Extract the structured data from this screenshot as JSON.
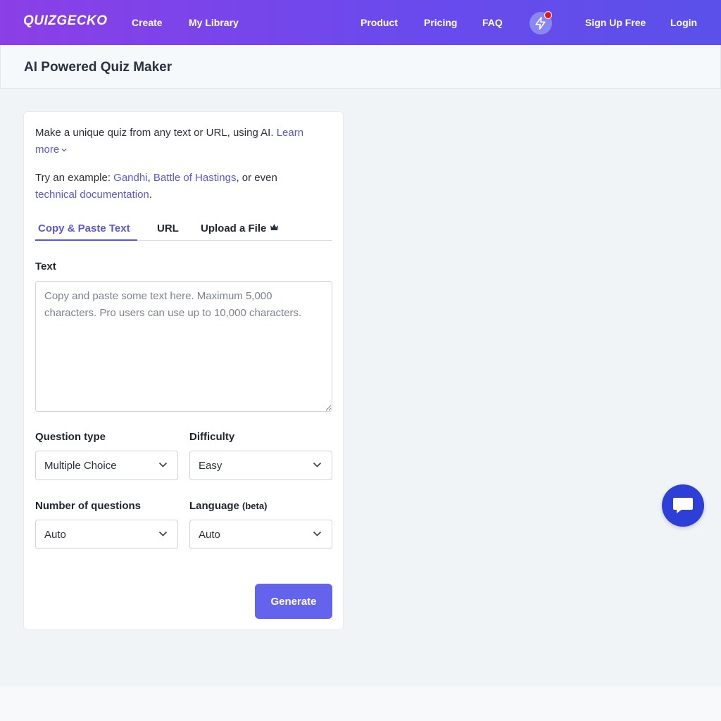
{
  "nav": {
    "logo": "QUIZGECKO",
    "left_links": [
      "Create",
      "My Library"
    ],
    "right_links": [
      "Product",
      "Pricing",
      "FAQ"
    ],
    "signup": "Sign Up Free",
    "login": "Login"
  },
  "page": {
    "title": "AI Powered Quiz Maker"
  },
  "intro": {
    "line1_text": "Make a unique quiz from any text or URL, using AI.",
    "learn_more": "Learn",
    "learn_more_2": "more",
    "try_prefix": "Try an example:",
    "example_1": "Gandhi",
    "example_2": "Battle of Hastings",
    "or_even": ", or even",
    "example_3": "technical documentation",
    "period": "."
  },
  "tabs": [
    {
      "label": "Copy & Paste Text",
      "active": true
    },
    {
      "label": "URL",
      "active": false
    },
    {
      "label": "Upload a File",
      "active": false
    }
  ],
  "form": {
    "text_label": "Text",
    "text_placeholder": "Copy and paste some text here. Maximum 5,000 characters. Pro users can use up to 10,000 characters.",
    "question_type_label": "Question type",
    "question_type_value": "Multiple Choice",
    "difficulty_label": "Difficulty",
    "difficulty_value": "Easy",
    "num_questions_label": "Number of questions",
    "num_questions_value": "Auto",
    "language_label": "Language",
    "language_suffix": "(beta)",
    "language_value": "Auto",
    "generate": "Generate"
  },
  "colors": {
    "nav_gradient_start": "#8b3fe6",
    "nav_gradient_end": "#5b50ea",
    "accent": "#5a56d9",
    "button": "#6463ee",
    "chat_button": "#2d3fd6",
    "notification": "#e8131a"
  },
  "icons": {
    "bolt": "lightning-icon",
    "chat": "chat-icon",
    "crown": "crown-icon",
    "chevron": "chevron-down-icon"
  }
}
